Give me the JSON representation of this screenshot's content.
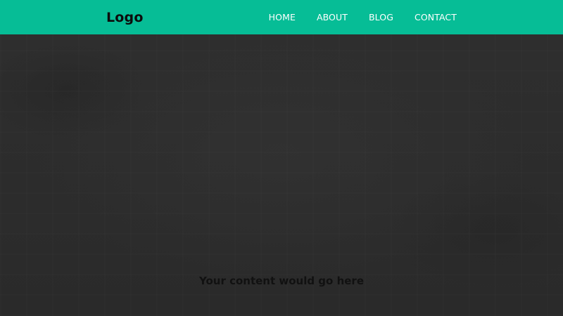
{
  "header": {
    "logo": "Logo",
    "nav": [
      {
        "label": "HOME"
      },
      {
        "label": "ABOUT"
      },
      {
        "label": "BLOG"
      },
      {
        "label": "CONTACT"
      }
    ]
  },
  "hero": {
    "content_text": "Your content would go here"
  },
  "colors": {
    "navbar_bg": "#06bd96",
    "hero_bg": "#2b2b2b",
    "nav_text": "#ffffff",
    "logo_text": "#0c0c0c"
  }
}
